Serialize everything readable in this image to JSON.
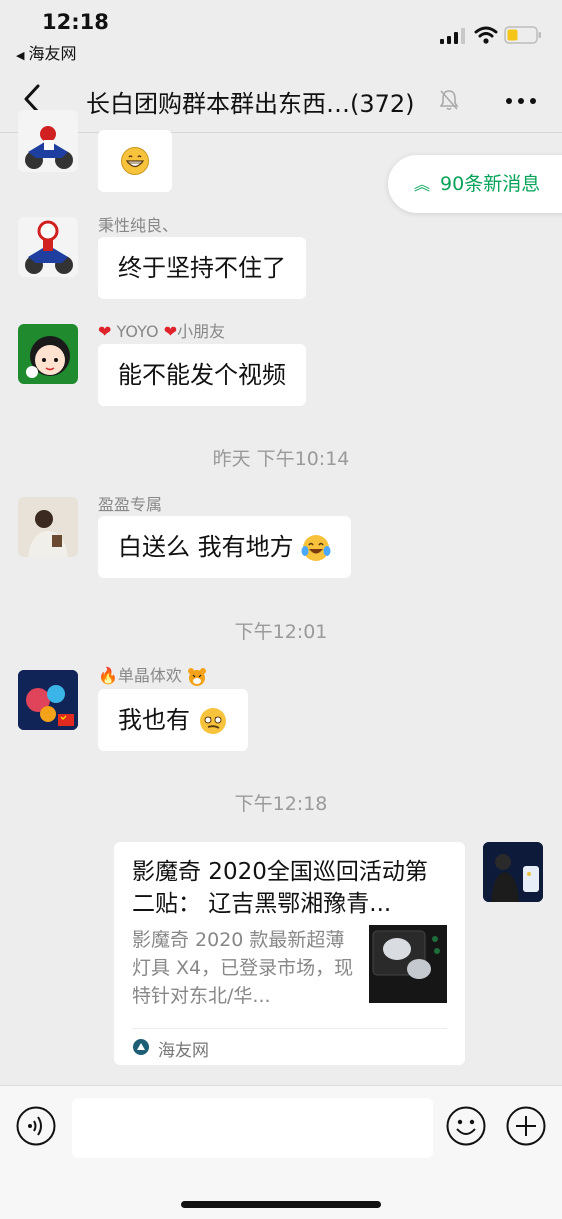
{
  "status_bar": {
    "time": "12:18",
    "back_app": "海友网"
  },
  "nav": {
    "title": "长白团购群本群出东西…(372)"
  },
  "new_messages": {
    "label": "90条新消息",
    "accent": "#07a35a"
  },
  "messages": [
    {
      "sender": "",
      "text": "",
      "emoji": "grinning-face"
    },
    {
      "sender": "秉性纯良、",
      "text": "终于坚持不住了"
    },
    {
      "sender_prefix_emoji": "red-heart",
      "sender": "YOYO",
      "sender_suffix_emoji": "red-heart",
      "sender_tail": "小朋友",
      "text": "能不能发个视频"
    },
    {
      "timestamp": "昨天 下午10:14"
    },
    {
      "sender": "盈盈专属",
      "text": "白送么 我有地方",
      "emoji": "tears-of-joy"
    },
    {
      "timestamp": "下午12:01"
    },
    {
      "sender_prefix_emoji": "fire",
      "sender": "单晶体欢",
      "sender_suffix_emoji": "tiger-face",
      "text": "我也有",
      "emoji": "smirking-face"
    },
    {
      "timestamp": "下午12:18"
    }
  ],
  "link_card": {
    "title": "影魔奇 2020全国巡回活动第二贴： 辽吉黑鄂湘豫青...",
    "description": "影魔奇 2020 款最新超薄灯具 X4，已登录市场，现特针对东北/华...",
    "source": "海友网"
  },
  "input_bar": {
    "placeholder": ""
  }
}
